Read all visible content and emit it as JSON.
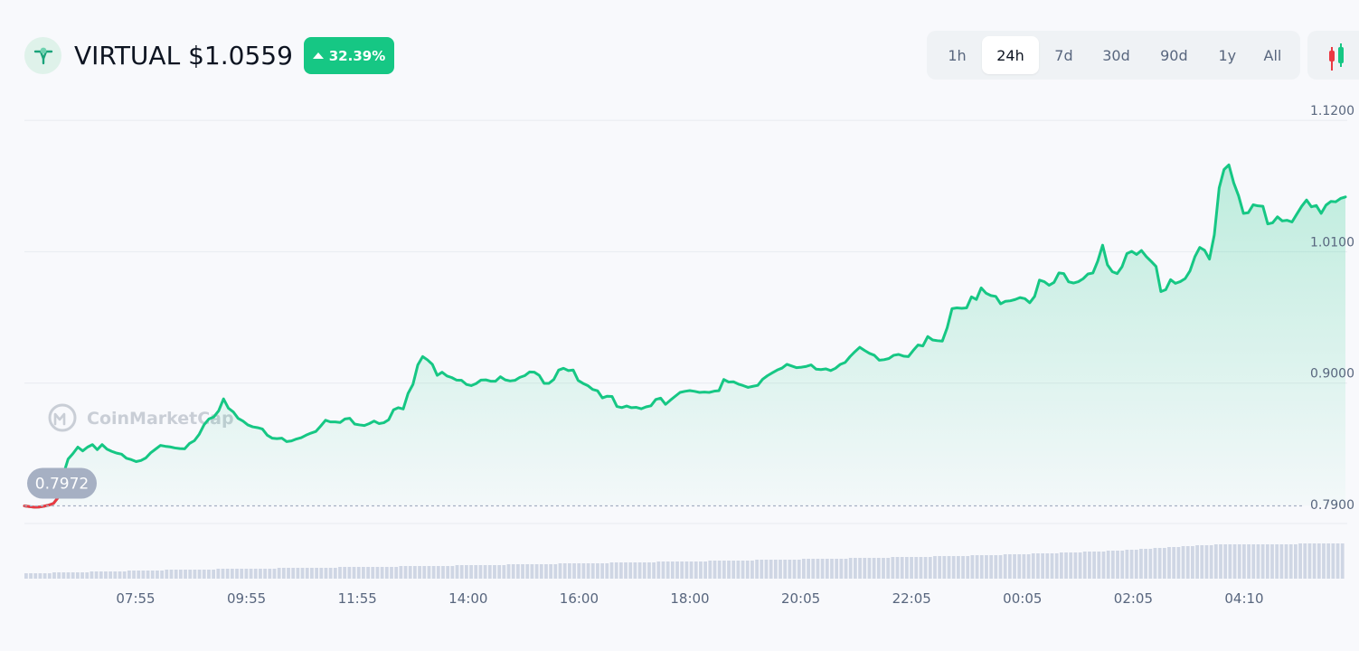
{
  "header": {
    "symbol": "VIRTUAL",
    "price": "$1.0559",
    "change": "32.39%",
    "ranges": [
      "1h",
      "24h",
      "7d",
      "30d",
      "90d",
      "1y",
      "All"
    ],
    "active_range": "24h"
  },
  "watermark": "CoinMarketCap",
  "colors": {
    "up": "#16c784",
    "down": "#ea3943",
    "grid": "#e8ebf0",
    "volume": "#cfd6e4"
  },
  "chart_data": {
    "type": "area",
    "ylim": [
      0.78,
      1.13
    ],
    "y_ticks": [
      "1.1200",
      "1.0100",
      "0.9000",
      "0.7900"
    ],
    "x_ticks": [
      "07:55",
      "09:55",
      "11:55",
      "14:00",
      "16:00",
      "18:00",
      "20:05",
      "22:05",
      "00:05",
      "02:05",
      "04:10"
    ],
    "baseline": {
      "value": 0.7972,
      "label": "0.7972"
    },
    "series": [
      {
        "values": [
          0.7972,
          0.7966,
          0.7961,
          0.7962,
          0.7969,
          0.7978,
          0.7993,
          0.8045,
          0.8233,
          0.8364,
          0.841,
          0.8464,
          0.8432,
          0.8464,
          0.8485,
          0.8443,
          0.8485,
          0.8447,
          0.8428,
          0.8414,
          0.8405,
          0.8371,
          0.8359,
          0.8343,
          0.8352,
          0.8373,
          0.8416,
          0.8447,
          0.8478,
          0.8471,
          0.8466,
          0.8457,
          0.8452,
          0.845,
          0.8495,
          0.8518,
          0.8572,
          0.8652,
          0.87,
          0.8717,
          0.8768,
          0.8868,
          0.879,
          0.8759,
          0.8705,
          0.8682,
          0.865,
          0.8634,
          0.8627,
          0.8616,
          0.8564,
          0.8539,
          0.8535,
          0.8539,
          0.851,
          0.8516,
          0.8532,
          0.8543,
          0.8564,
          0.8581,
          0.8595,
          0.864,
          0.8689,
          0.8675,
          0.8675,
          0.867,
          0.87,
          0.8705,
          0.8657,
          0.865,
          0.8645,
          0.8661,
          0.8682,
          0.8661,
          0.8668,
          0.8693,
          0.8776,
          0.8794,
          0.8783,
          0.8914,
          0.8989,
          0.9152,
          0.9222,
          0.9194,
          0.9157,
          0.9065,
          0.9091,
          0.906,
          0.9046,
          0.9025,
          0.9023,
          0.8989,
          0.8979,
          0.8996,
          0.9025,
          0.9027,
          0.9016,
          0.9016,
          0.9053,
          0.9027,
          0.9018,
          0.9023,
          0.9048,
          0.9062,
          0.9093,
          0.9091,
          0.9065,
          0.8998,
          0.8998,
          0.903,
          0.9109,
          0.9124,
          0.9105,
          0.9109,
          0.9023,
          0.8998,
          0.8979,
          0.8947,
          0.8936,
          0.8876,
          0.889,
          0.8888,
          0.8804,
          0.8795,
          0.8808,
          0.8794,
          0.8797,
          0.8785,
          0.8801,
          0.881,
          0.8863,
          0.8874,
          0.8822,
          0.8857,
          0.889,
          0.8922,
          0.8931,
          0.8937,
          0.8931,
          0.8922,
          0.8925,
          0.8922,
          0.8932,
          0.8936,
          0.903,
          0.9009,
          0.9011,
          0.8992,
          0.8979,
          0.8964,
          0.8973,
          0.8981,
          0.9032,
          0.9062,
          0.9086,
          0.9109,
          0.9126,
          0.9157,
          0.9143,
          0.9129,
          0.9133,
          0.914,
          0.9152,
          0.9117,
          0.9113,
          0.9119,
          0.9105,
          0.9124,
          0.9157,
          0.9173,
          0.9222,
          0.9263,
          0.93,
          0.9273,
          0.9249,
          0.9233,
          0.9192,
          0.9196,
          0.9206,
          0.9233,
          0.924,
          0.9226,
          0.9222,
          0.9273,
          0.9319,
          0.9311,
          0.939,
          0.9361,
          0.9355,
          0.9352,
          0.9463,
          0.9623,
          0.963,
          0.9626,
          0.963,
          0.9722,
          0.97,
          0.9797,
          0.9753,
          0.9733,
          0.9726,
          0.9664,
          0.9685,
          0.9689,
          0.97,
          0.9716,
          0.9707,
          0.9673,
          0.9726,
          0.9862,
          0.9849,
          0.9819,
          0.9843,
          0.9922,
          0.9917,
          0.9848,
          0.9838,
          0.9849,
          0.9874,
          0.9914,
          0.9922,
          1.0021,
          1.0155,
          0.999,
          0.9933,
          0.9917,
          0.9974,
          1.0084,
          1.0103,
          1.0077,
          1.011,
          1.0059,
          1.0019,
          0.9977,
          0.9766,
          0.9782,
          0.9866,
          0.9835,
          0.985,
          0.9875,
          0.994,
          1.0058,
          1.0136,
          1.0112,
          1.0038,
          1.0241,
          1.0634,
          1.0788,
          1.0827,
          1.0676,
          1.0568,
          1.0421,
          1.0427,
          1.0493,
          1.0484,
          1.0481,
          1.0333,
          1.0342,
          1.0392,
          1.0358,
          1.0363,
          1.0349,
          1.0416,
          1.0481,
          1.0533,
          1.0476,
          1.0487,
          1.0421,
          1.049,
          1.0521,
          1.0518,
          1.0546,
          1.0559
        ]
      }
    ],
    "volume": {
      "values": [
        6,
        6,
        6,
        6,
        6,
        6,
        7,
        7,
        7,
        7,
        7,
        7,
        7,
        7,
        8,
        8,
        8,
        8,
        8,
        8,
        8,
        8,
        9,
        9,
        9,
        9,
        9,
        9,
        9,
        9,
        10,
        10,
        10,
        10,
        10,
        10,
        10,
        10,
        10,
        10,
        10,
        11,
        11,
        11,
        11,
        11,
        11,
        11,
        11,
        11,
        11,
        11,
        11,
        11,
        12,
        12,
        12,
        12,
        12,
        12,
        12,
        12,
        12,
        12,
        12,
        12,
        12,
        13,
        13,
        13,
        13,
        13,
        13,
        13,
        13,
        13,
        13,
        13,
        13,
        13,
        14,
        14,
        14,
        14,
        14,
        14,
        14,
        14,
        14,
        14,
        14,
        14,
        15,
        15,
        15,
        15,
        15,
        15,
        15,
        15,
        15,
        15,
        15,
        16,
        16,
        16,
        16,
        16,
        16,
        16,
        16,
        16,
        16,
        16,
        17,
        17,
        17,
        17,
        17,
        17,
        17,
        17,
        17,
        17,
        17,
        18,
        18,
        18,
        18,
        18,
        18,
        18,
        18,
        18,
        18,
        19,
        19,
        19,
        19,
        19,
        19,
        19,
        19,
        19,
        19,
        19,
        20,
        20,
        20,
        20,
        20,
        20,
        20,
        20,
        20,
        20,
        21,
        21,
        21,
        21,
        21,
        21,
        21,
        21,
        21,
        21,
        22,
        22,
        22,
        22,
        22,
        22,
        22,
        22,
        22,
        22,
        23,
        23,
        23,
        23,
        23,
        23,
        23,
        23,
        23,
        24,
        24,
        24,
        24,
        24,
        24,
        24,
        24,
        24,
        25,
        25,
        25,
        25,
        25,
        25,
        25,
        25,
        26,
        26,
        26,
        26,
        26,
        26,
        26,
        27,
        27,
        27,
        27,
        27,
        27,
        28,
        28,
        28,
        28,
        28,
        28,
        29,
        29,
        29,
        29,
        29,
        30,
        30,
        30,
        30,
        30,
        31,
        31,
        31,
        31,
        32,
        32,
        32,
        33,
        33,
        33,
        34,
        34,
        34,
        35,
        35,
        35,
        36,
        36,
        36,
        37,
        37,
        37,
        37,
        38,
        38,
        38,
        38,
        38,
        38,
        38,
        38,
        38,
        38,
        38,
        38,
        38,
        38,
        38,
        38,
        38,
        38,
        39,
        39,
        39,
        39,
        39,
        39,
        39,
        39,
        39,
        39
      ]
    }
  }
}
